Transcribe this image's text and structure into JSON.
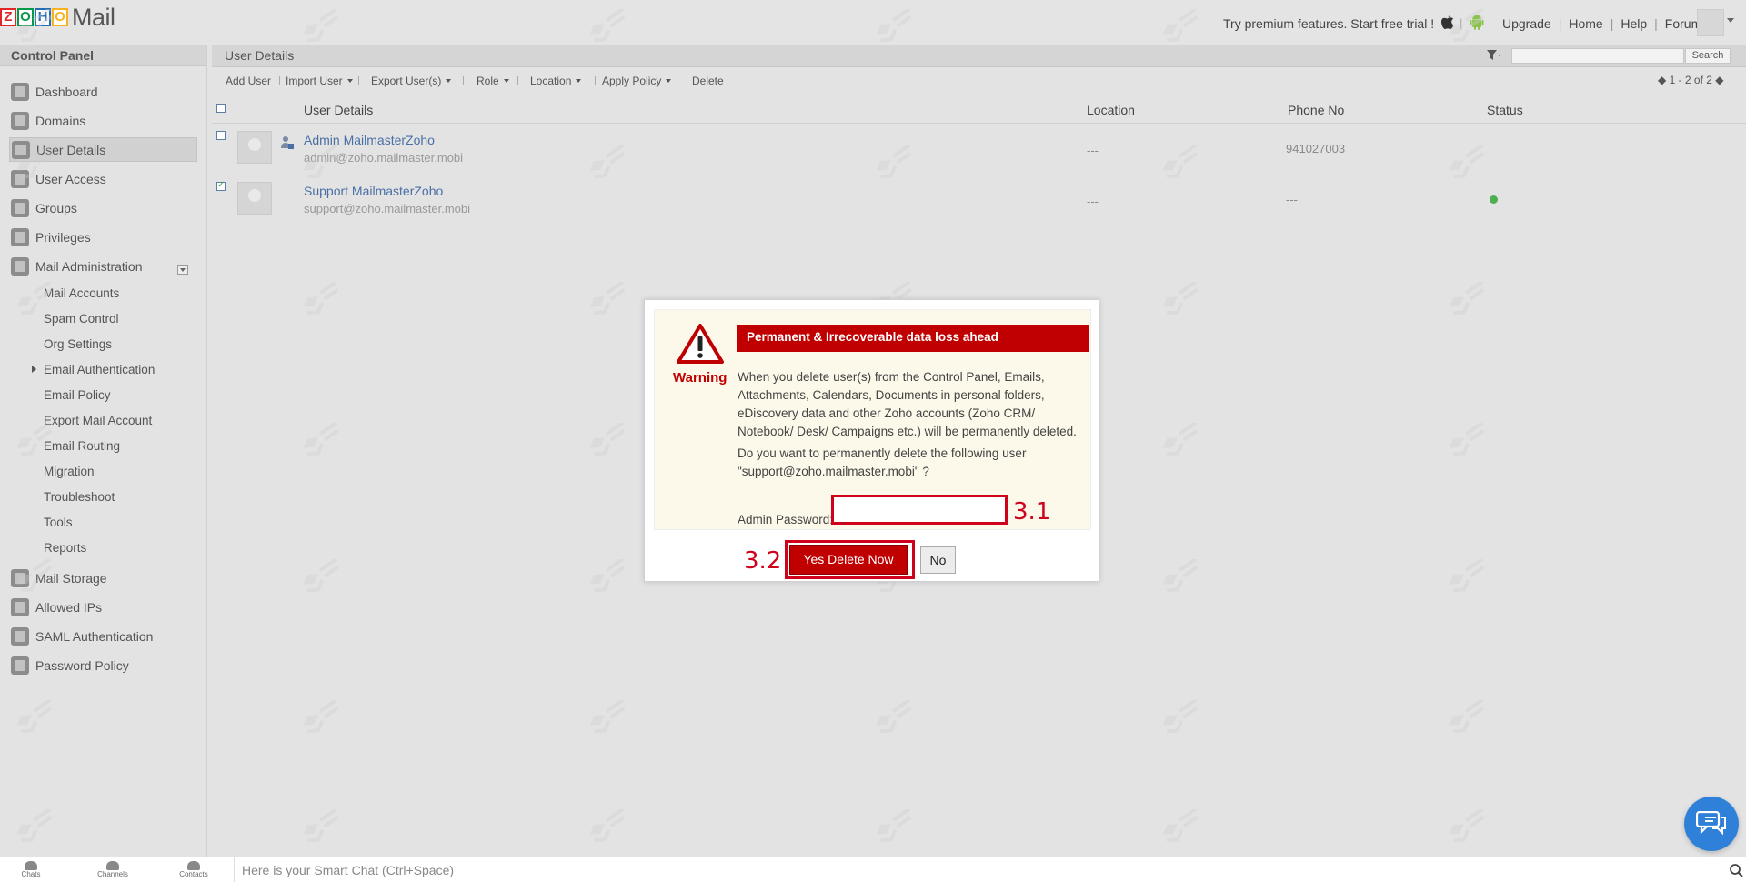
{
  "app": {
    "logo_letters": [
      "Z",
      "O",
      "H",
      "O"
    ],
    "logo_colors": [
      "#e42527",
      "#089949",
      "#226db4",
      "#f9b21d"
    ],
    "logo_suffix": "Mail"
  },
  "header": {
    "promo": "Try premium features. Start free trial !",
    "links": [
      "Upgrade",
      "Home",
      "Help",
      "Forum"
    ]
  },
  "sidebar": {
    "title": "Control Panel",
    "items": [
      {
        "label": "Dashboard",
        "icon": "dashboard-icon"
      },
      {
        "label": "Domains",
        "icon": "domains-icon"
      },
      {
        "label": "User Details",
        "icon": "user-icon",
        "active": true
      },
      {
        "label": "User Access",
        "icon": "user-access-icon"
      },
      {
        "label": "Groups",
        "icon": "groups-icon"
      },
      {
        "label": "Privileges",
        "icon": "privileges-icon"
      },
      {
        "label": "Mail Administration",
        "icon": "mail-icon"
      }
    ],
    "sub_items": [
      "Mail Accounts",
      "Spam Control",
      "Org Settings",
      "Email Authentication",
      "Email Policy",
      "Export Mail Account",
      "Email Routing",
      "Migration",
      "Troubleshoot",
      "Tools",
      "Reports"
    ],
    "items_after": [
      {
        "label": "Mail Storage",
        "icon": "storage-icon"
      },
      {
        "label": "Allowed IPs",
        "icon": "allowed-ips-icon"
      },
      {
        "label": "SAML Authentication",
        "icon": "saml-icon"
      },
      {
        "label": "Password Policy",
        "icon": "lock-icon"
      }
    ]
  },
  "main": {
    "title": "User Details",
    "search_button": "Search",
    "toolbar": [
      "Add User",
      "Import User",
      "Export User(s)",
      "Role",
      "Location",
      "Apply Policy",
      "Delete"
    ],
    "pager": "1 - 2 of 2",
    "columns": [
      "User Details",
      "Location",
      "Phone No",
      "Status"
    ],
    "rows": [
      {
        "name": "Admin MailmasterZoho",
        "email": "admin@zoho.mailmaster.mobi",
        "location": "---",
        "phone": "941027003",
        "status": "",
        "checked": false,
        "admin": true
      },
      {
        "name": "Support MailmasterZoho",
        "email": "support@zoho.mailmaster.mobi",
        "location": "---",
        "phone": "---",
        "status": "active",
        "checked": true,
        "admin": false
      }
    ]
  },
  "dialog": {
    "warning_label": "Warning",
    "banner": "Permanent & Irrecoverable data loss ahead",
    "message": "When you delete user(s) from the Control Panel, Emails, Attachments, Calendars, Documents in personal folders, eDiscovery data and other Zoho accounts (Zoho CRM/ Notebook/ Desk/ Campaigns etc.) will be permanently deleted.",
    "question": "Do you want to permanently delete the following user \"support@zoho.mailmaster.mobi\" ?",
    "password_label": "Admin Password:",
    "password_value": "",
    "annotation_1": "3.1",
    "annotation_2": "3.2",
    "yes_label": "Yes Delete Now",
    "no_label": "No"
  },
  "bottombar": {
    "items": [
      "Chats",
      "Channels",
      "Contacts"
    ],
    "smartchat_placeholder": "Here is your Smart Chat (Ctrl+Space)"
  },
  "colors": {
    "accent_red": "#c00000",
    "annotation_red": "#d0021b",
    "link_blue": "#4a6fa5",
    "status_green": "#4caf50",
    "chat_blue": "#2f80d9"
  }
}
